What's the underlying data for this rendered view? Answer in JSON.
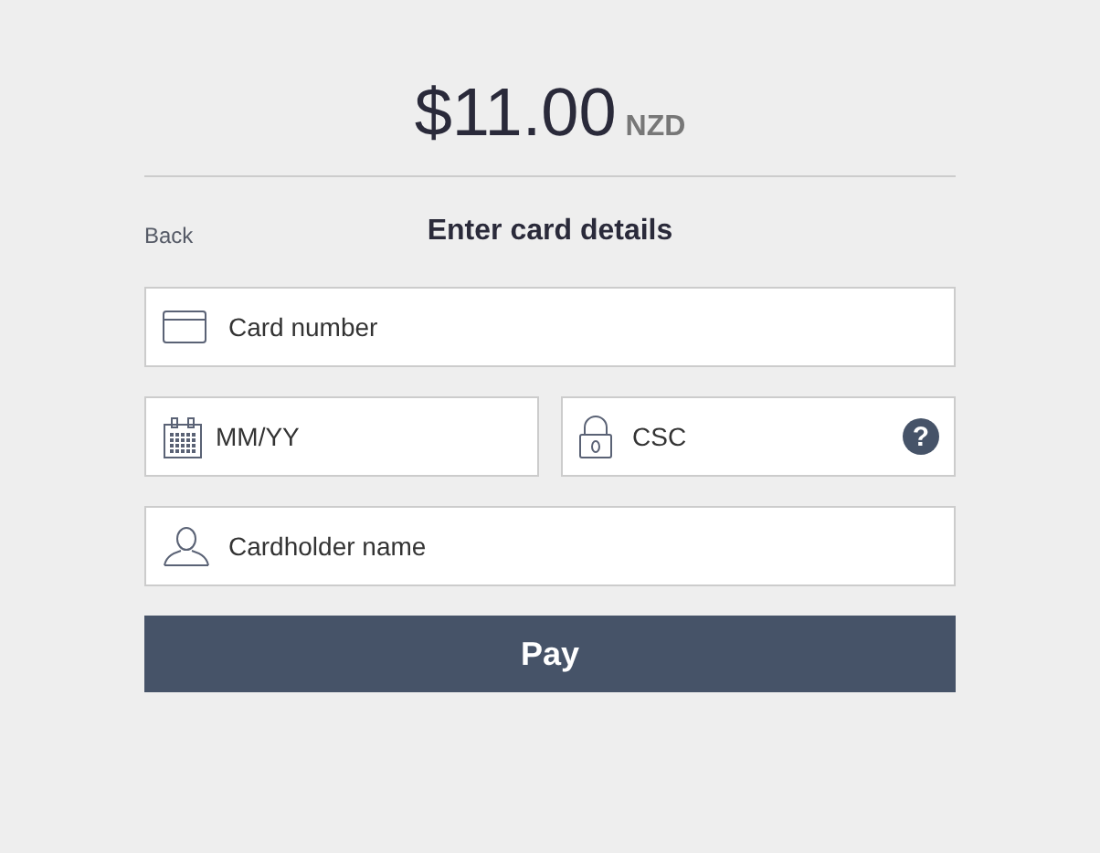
{
  "amount": "$11.00",
  "currency": "NZD",
  "back": "Back",
  "title": "Enter card details",
  "rows": [
    [
      {
        "kind": "card",
        "placeholder": "Card number"
      }
    ],
    [
      {
        "kind": "expiry",
        "placeholder": "MM/YY"
      },
      {
        "kind": "csc",
        "placeholder": "CSC",
        "help": "?"
      }
    ],
    [
      {
        "kind": "person",
        "placeholder": "Cardholder name"
      }
    ]
  ],
  "pay": "Pay"
}
